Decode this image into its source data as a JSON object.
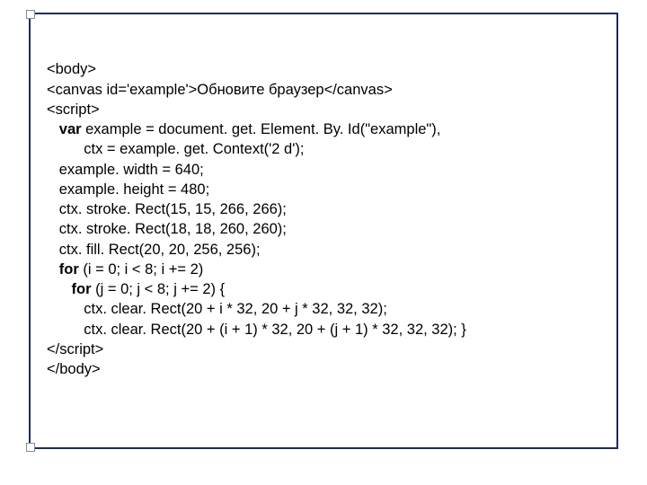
{
  "code": {
    "l1": "<body>",
    "l2": "<canvas id='example'>Обновите браузер</canvas>",
    "l3": "<script>",
    "l4a": "   ",
    "l4k": "var",
    "l4b": " example = document. get. Element. By. Id(\"example\"),",
    "l5": "         ctx = example. get. Context('2 d');",
    "l6": "   example. width = 640;",
    "l7": "   example. height = 480;",
    "l8": "   ctx. stroke. Rect(15, 15, 266, 266);",
    "l9": "   ctx. stroke. Rect(18, 18, 260, 260);",
    "l10": "   ctx. fill. Rect(20, 20, 256, 256);",
    "l11a": "   ",
    "l11k": "for",
    "l11b": " (i = 0; i < 8; i += 2)",
    "l12a": "      ",
    "l12k": "for",
    "l12b": " (j = 0; j < 8; j += 2) {",
    "l13": "         ctx. clear. Rect(20 + i * 32, 20 + j * 32, 32, 32);",
    "l14": "         ctx. clear. Rect(20 + (i + 1) * 32, 20 + (j + 1) * 32, 32, 32); }",
    "l15": "</script>",
    "l16": "</body>"
  }
}
